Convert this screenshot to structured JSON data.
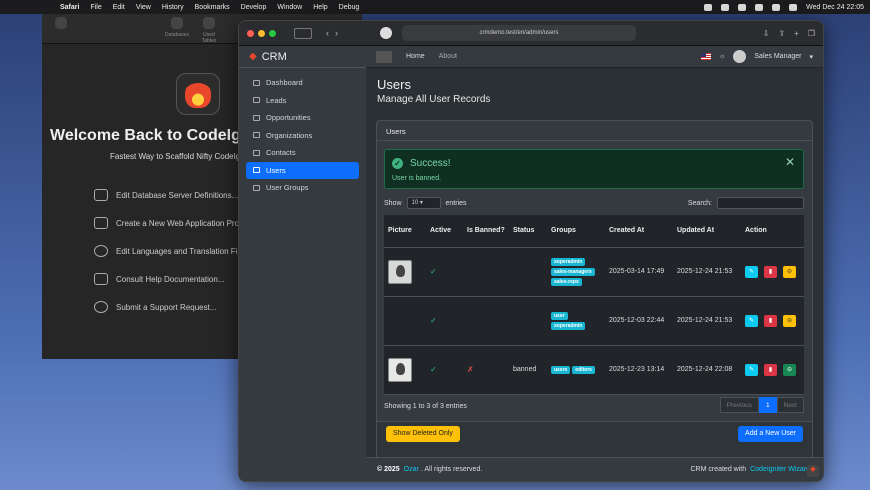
{
  "menubar": {
    "app": "Safari",
    "items": [
      "File",
      "Edit",
      "View",
      "History",
      "Bookmarks",
      "Develop",
      "Window",
      "Help",
      "Debug"
    ],
    "clock": "Wed Dec 24  22:05"
  },
  "bg_window": {
    "toolbar": [
      "",
      "Databases",
      "Used Tables"
    ],
    "welcome": "Welcome Back to CodeIgnit",
    "tagline": "Fastest Way to Scaffold Nifty CodeIgn",
    "links": [
      {
        "icon": "database-icon",
        "label": "Edit Database Server Definitions..."
      },
      {
        "icon": "window-icon",
        "label": "Create a New Web Application Pro"
      },
      {
        "icon": "globe-icon",
        "label": "Edit Languages and Translation Fi"
      },
      {
        "icon": "book-icon",
        "label": "Consult Help Documentation..."
      },
      {
        "icon": "help-icon",
        "label": "Submit a Support Request..."
      }
    ]
  },
  "browser": {
    "url": "crmdemo.test/en/admin/users"
  },
  "app": {
    "brand": "CRM",
    "sidebar": [
      {
        "label": "Dashboard",
        "active": false
      },
      {
        "label": "Leads",
        "active": false
      },
      {
        "label": "Opportunities",
        "active": false
      },
      {
        "label": "Organizations",
        "active": false
      },
      {
        "label": "Contacts",
        "active": false
      },
      {
        "label": "Users",
        "active": true
      },
      {
        "label": "User Groups",
        "active": false
      }
    ],
    "topnav": {
      "home": "Home",
      "about": "About",
      "user": "Sales Manager"
    },
    "page_title": "Users",
    "page_subtitle": "Manage All User Records",
    "card_title": "Users",
    "alert": {
      "title": "Success!",
      "message": "User is banned."
    },
    "controls": {
      "show": "Show",
      "entries_value": "10",
      "entries": "entries",
      "search": "Search:"
    },
    "table": {
      "headers": [
        "Picture",
        "Active",
        "Is Banned?",
        "Status",
        "Groups",
        "Created At",
        "Updated At",
        "Action"
      ],
      "rows": [
        {
          "active": "✓",
          "banned": "",
          "status": "",
          "groups": [
            "superadmin",
            "sales-managers",
            "sales-reps"
          ],
          "created": "2025-03-14 17:49",
          "updated": "2025-12-24 21:53",
          "third_action": "ban"
        },
        {
          "active": "✓",
          "banned": "",
          "status": "",
          "groups": [
            "user",
            "superadmin"
          ],
          "created": "2025-12-03 22:44",
          "updated": "2025-12-24 21:53",
          "third_action": "ban"
        },
        {
          "active": "✓",
          "banned": "✗",
          "status": "banned",
          "groups": [
            "users",
            "editors"
          ],
          "created": "2025-12-23 13:14",
          "updated": "2025-12-24 22:08",
          "third_action": "unban"
        }
      ]
    },
    "showing": "Showing 1 to 3 of 3 entries",
    "pager": {
      "prev": "Previous",
      "page": "1",
      "next": "Next"
    },
    "buttons": {
      "show_deleted": "Show Deleted Only",
      "add": "Add a New User"
    },
    "footer": {
      "copy": "© 2025",
      "author": "Ozar",
      "rights": ". All rights reserved.",
      "credit": "CRM created with",
      "tool": "CodeIgniter Wizard"
    }
  }
}
